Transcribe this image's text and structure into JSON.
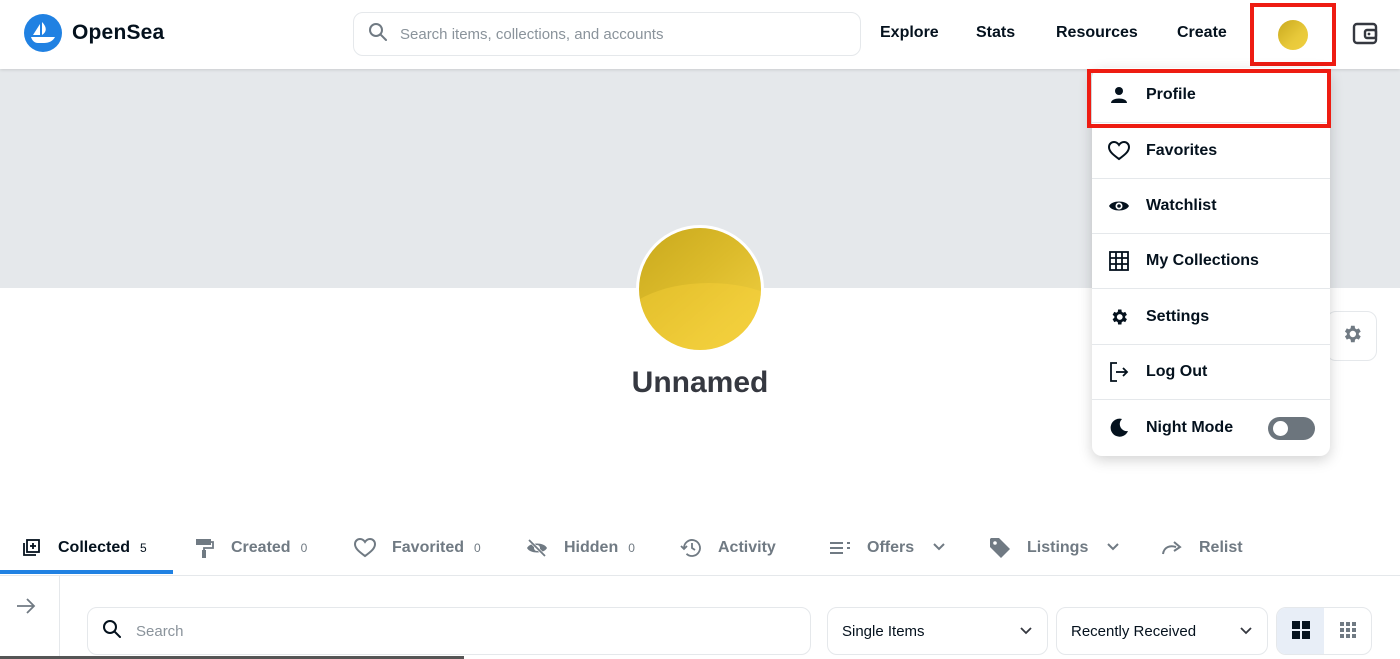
{
  "header": {
    "brand": "OpenSea",
    "search_placeholder": "Search items, collections, and accounts",
    "nav": [
      "Explore",
      "Stats",
      "Resources",
      "Create"
    ],
    "icons": {
      "logo": "opensea-boat-logo",
      "search": "search-icon",
      "wallet": "wallet-icon"
    }
  },
  "profile": {
    "name": "Unnamed",
    "avatar_colors": [
      "#c9a91d",
      "#efcc3e"
    ]
  },
  "dropdown": {
    "items": [
      {
        "label": "Profile",
        "icon": "person-icon"
      },
      {
        "label": "Favorites",
        "icon": "heart-icon"
      },
      {
        "label": "Watchlist",
        "icon": "eye-icon"
      },
      {
        "label": "My Collections",
        "icon": "grid-icon"
      },
      {
        "label": "Settings",
        "icon": "gear-icon"
      },
      {
        "label": "Log Out",
        "icon": "logout-icon"
      },
      {
        "label": "Night Mode",
        "icon": "moon-icon"
      }
    ],
    "night_mode_on": false
  },
  "tabs": [
    {
      "label": "Collected",
      "count": "5",
      "icon": "collected-icon"
    },
    {
      "label": "Created",
      "count": "0",
      "icon": "paint-roller-icon"
    },
    {
      "label": "Favorited",
      "count": "0",
      "icon": "heart-icon"
    },
    {
      "label": "Hidden",
      "count": "0",
      "icon": "eye-off-icon"
    },
    {
      "label": "Activity",
      "icon": "history-icon"
    },
    {
      "label": "Offers",
      "icon": "list-icon"
    },
    {
      "label": "Listings",
      "icon": "tag-icon"
    },
    {
      "label": "Relist",
      "icon": "redo-arrow-icon"
    }
  ],
  "filters": {
    "search_placeholder": "Search",
    "item_type": "Single Items",
    "sort": "Recently Received"
  },
  "colors": {
    "accent": "#2081e2",
    "highlight": "#ee1c12",
    "banner": "#e5e8eb"
  }
}
